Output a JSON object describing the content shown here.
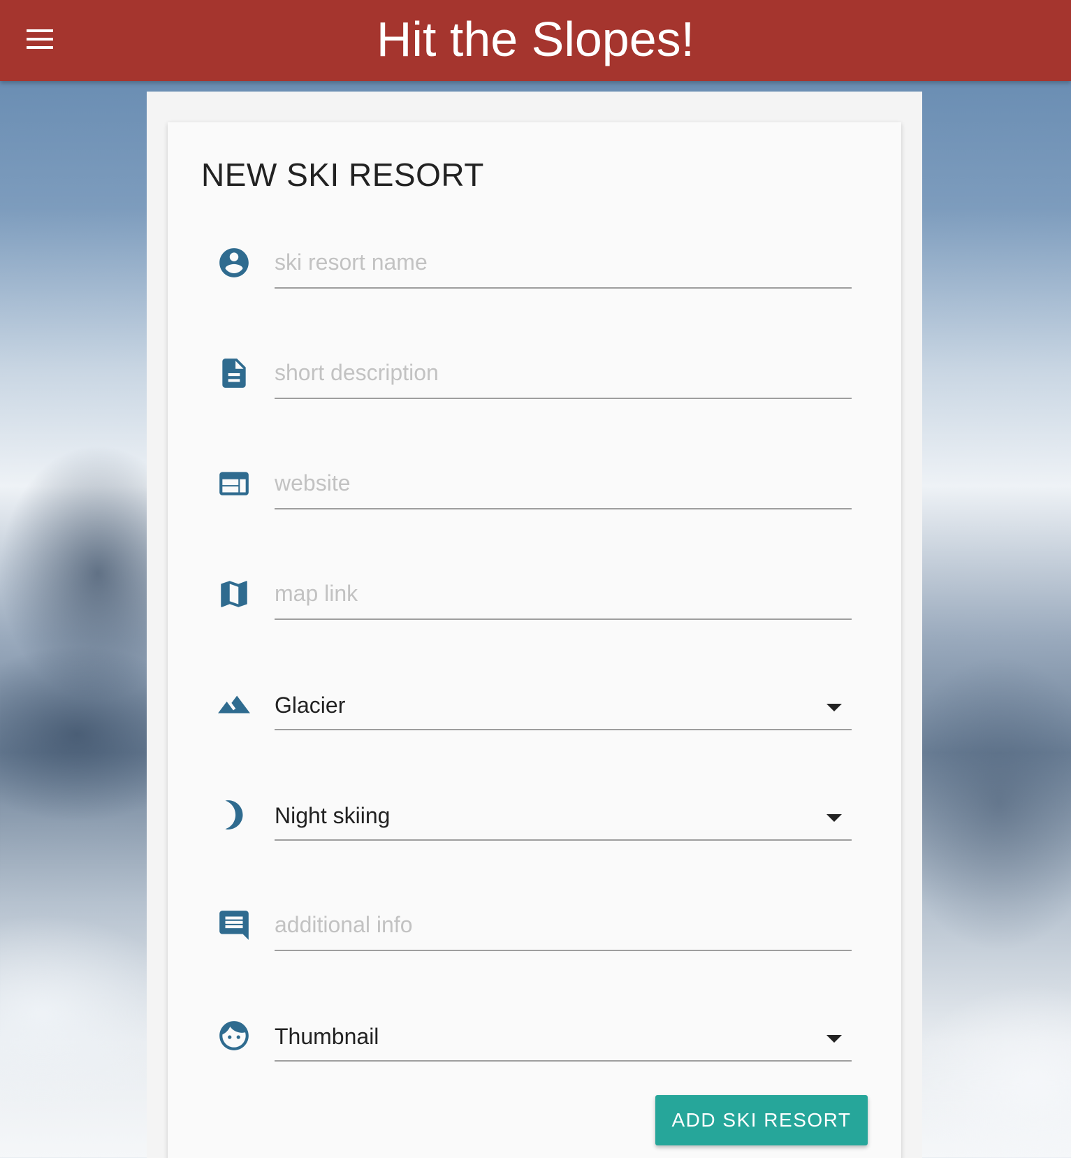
{
  "app": {
    "title": "Hit the Slopes!",
    "accent_color": "#a5352e",
    "icon_color": "#2f6b8f"
  },
  "form": {
    "title": "NEW SKI RESORT",
    "fields": [
      {
        "icon": "account-circle-icon",
        "type": "text",
        "value": "",
        "placeholder": "ski resort name"
      },
      {
        "icon": "description-icon",
        "type": "text",
        "value": "",
        "placeholder": "short description"
      },
      {
        "icon": "web-icon",
        "type": "text",
        "value": "",
        "placeholder": "website"
      },
      {
        "icon": "map-icon",
        "type": "text",
        "value": "",
        "placeholder": "map link"
      },
      {
        "icon": "terrain-icon",
        "type": "select",
        "selected": "Glacier"
      },
      {
        "icon": "moon-icon",
        "type": "select",
        "selected": "Night skiing"
      },
      {
        "icon": "comment-icon",
        "type": "text",
        "value": "",
        "placeholder": "additional info"
      },
      {
        "icon": "face-icon",
        "type": "select",
        "selected": "Thumbnail"
      }
    ],
    "submit_label": "ADD SKI RESORT",
    "submit_color": "#26a69a"
  }
}
